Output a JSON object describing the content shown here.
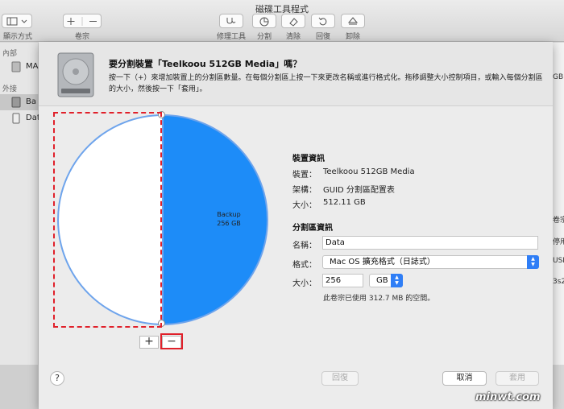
{
  "window": {
    "title": "磁碟工具程式",
    "toolbar": {
      "view_label": "顯示方式",
      "volume_label": "卷宗",
      "firstaid_label": "修理工具",
      "partition_label": "分割",
      "erase_label": "清除",
      "restore_label": "回復",
      "unmount_label": "卸除"
    }
  },
  "sidebar": {
    "internal_header": "內部",
    "internal_item": "MA",
    "external_header": "外接",
    "items": [
      {
        "label": "Ba",
        "selected": true
      },
      {
        "label": "Dat",
        "selected": false
      }
    ]
  },
  "right_partial": {
    "t1": "GB",
    "t2": "卷宗",
    "t3": "停用",
    "t4": "USB",
    "t5": "3s2"
  },
  "sheet": {
    "title": "要分割裝置「Teelkoou 512GB Media」嗎？",
    "description": "按一下（+）來增加裝置上的分割區數量。在每個分割區上按一下來更改名稱或進行格式化。拖移調整大小控制項目，或輸入每個分割區的大小，然後按一下「套用」。",
    "pie": {
      "slices": [
        {
          "name": "Data",
          "size": "256 GB",
          "fraction": 0.5,
          "color": "#1d8cf8"
        },
        {
          "name": "Backup",
          "size": "256 GB",
          "fraction": 0.5,
          "color": "#ffffff"
        }
      ]
    },
    "add_button": "+",
    "remove_button": "−",
    "device_info": {
      "header": "裝置資訊",
      "device_key": "裝置：",
      "device_val": "Teelkoou 512GB Media",
      "scheme_key": "架構：",
      "scheme_val": "GUID 分割區配置表",
      "size_key": "大小：",
      "size_val": "512.11 GB"
    },
    "partition_info": {
      "header": "分割區資訊",
      "name_key": "名稱：",
      "name_val": "Data",
      "format_key": "格式：",
      "format_val": "Mac OS 擴充格式（日誌式）",
      "size_key": "大小：",
      "size_val": "256",
      "unit_val": "GB",
      "note": "此卷宗已使用 312.7 MB 的空間。"
    },
    "help": "?",
    "revert_button": "回復",
    "cancel_button": "取消",
    "apply_button": "套用"
  },
  "watermark": "minwt.com",
  "colors": {
    "accent": "#2f7ef6",
    "highlight": "#e0202a"
  }
}
